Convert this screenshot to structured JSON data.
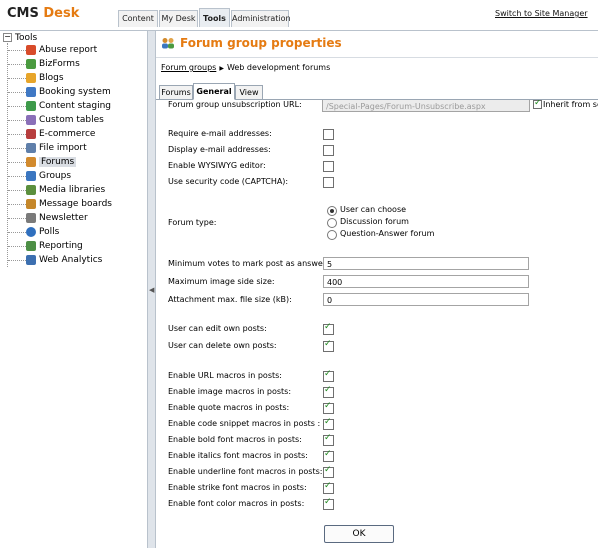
{
  "header": {
    "logo_part1": "CMS",
    "logo_part2": "Desk",
    "tabs": [
      {
        "label": "Content"
      },
      {
        "label": "My Desk"
      },
      {
        "label": "Tools",
        "active": true
      },
      {
        "label": "Administration"
      }
    ],
    "switch_link": "Switch to Site Manager"
  },
  "tree": {
    "root_label": "Tools",
    "items": [
      {
        "label": "Abuse report",
        "icon": "abuse-report-icon",
        "color": "#d84b2a"
      },
      {
        "label": "BizForms",
        "icon": "bizforms-icon",
        "color": "#4a9a3f"
      },
      {
        "label": "Blogs",
        "icon": "blogs-icon",
        "color": "#e7a52a"
      },
      {
        "label": "Booking system",
        "icon": "booking-system-icon",
        "color": "#3f78c4"
      },
      {
        "label": "Content staging",
        "icon": "content-staging-icon",
        "color": "#3d9a4a"
      },
      {
        "label": "Custom tables",
        "icon": "custom-tables-icon",
        "color": "#8a6fb8"
      },
      {
        "label": "E-commerce",
        "icon": "e-commerce-icon",
        "color": "#b73d3d"
      },
      {
        "label": "File import",
        "icon": "file-import-icon",
        "color": "#5f7faa"
      },
      {
        "label": "Forums",
        "icon": "forums-icon",
        "color": "#d28a2d",
        "selected": true
      },
      {
        "label": "Groups",
        "icon": "groups-icon",
        "color": "#3a76c0"
      },
      {
        "label": "Media libraries",
        "icon": "media-libraries-icon",
        "color": "#5b8f3d"
      },
      {
        "label": "Message boards",
        "icon": "message-boards-icon",
        "color": "#c5872a"
      },
      {
        "label": "Newsletter",
        "icon": "newsletter-icon",
        "color": "#7a7a7a"
      },
      {
        "label": "Polls",
        "icon": "polls-icon",
        "color": "#2f6fbe"
      },
      {
        "label": "Reporting",
        "icon": "reporting-icon",
        "color": "#4d8f45"
      },
      {
        "label": "Web Analytics",
        "icon": "web-analytics-icon",
        "color": "#3c6fb0"
      }
    ]
  },
  "page": {
    "title": "Forum group properties",
    "breadcrumb_link": "Forum groups",
    "breadcrumb_current": "Web development forums",
    "tabs": [
      {
        "label": "Forums"
      },
      {
        "label": "General",
        "active": true
      },
      {
        "label": "View"
      }
    ]
  },
  "form": {
    "unsub_label": "Forum group unsubscription URL:",
    "unsub_value": "/Special-Pages/Forum-Unsubscribe.aspx",
    "inherit_label": "Inherit from se",
    "require_email_label": "Require e-mail addresses:",
    "display_email_label": "Display e-mail addresses:",
    "wysiwyg_label": "Enable WYSIWYG editor:",
    "captcha_label": "Use security code (CAPTCHA):",
    "forum_type_label": "Forum type:",
    "forum_type_options": [
      "User can choose",
      "Discussion forum",
      "Question-Answer forum"
    ],
    "forum_type_selected": "User can choose",
    "min_votes_label": "Minimum votes to mark post as answer:",
    "min_votes_value": "5",
    "max_image_label": "Maximum image side size:",
    "max_image_value": "400",
    "attach_size_label": "Attachment max. file size (kB):",
    "attach_size_value": "0",
    "edit_posts_label": "User can edit own posts:",
    "delete_posts_label": "User can delete own posts:",
    "url_macros_label": "Enable URL macros in posts:",
    "image_macros_label": "Enable image macros in posts:",
    "quote_macros_label": "Enable quote macros in posts:",
    "code_macros_label": "Enable code snippet macros in posts :",
    "bold_macros_label": "Enable bold font macros in posts:",
    "italics_macros_label": "Enable italics font macros in posts:",
    "underline_macros_label": "Enable underline font macros in posts:",
    "strike_macros_label": "Enable strike font macros in posts:",
    "color_macros_label": "Enable font color macros in posts:",
    "ok_label": "OK"
  },
  "colors": {
    "accent": "#e57b12",
    "check": "#1f8a1f"
  }
}
